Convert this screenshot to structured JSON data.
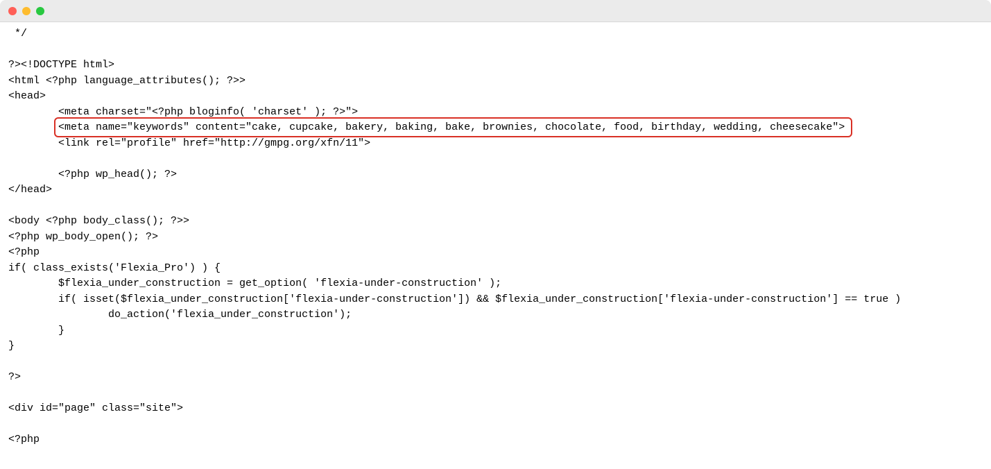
{
  "code": {
    "lines": [
      " */",
      "",
      "?><!DOCTYPE html>",
      "<html <?php language_attributes(); ?>>",
      "<head>",
      "        <meta charset=\"<?php bloginfo( 'charset' ); ?>\">",
      "        <meta name=\"keywords\" content=\"cake, cupcake, bakery, baking, bake, brownies, chocolate, food, birthday, wedding, cheesecake\">",
      "        <link rel=\"profile\" href=\"http://gmpg.org/xfn/11\">",
      "",
      "        <?php wp_head(); ?>",
      "</head>",
      "",
      "<body <?php body_class(); ?>>",
      "<?php wp_body_open(); ?>",
      "<?php",
      "if( class_exists('Flexia_Pro') ) {",
      "        $flexia_under_construction = get_option( 'flexia-under-construction' );",
      "        if( isset($flexia_under_construction['flexia-under-construction']) && $flexia_under_construction['flexia-under-construction'] == true )",
      "                do_action('flexia_under_construction');",
      "        }",
      "}",
      "",
      "?>",
      "",
      "<div id=\"page\" class=\"site\">",
      "",
      "<?php"
    ],
    "highlighted_line_index": 6
  }
}
